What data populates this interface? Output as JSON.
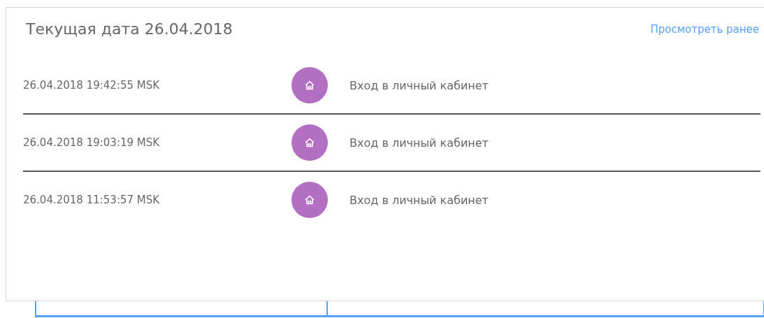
{
  "header": {
    "title": "Текущая дата 26.04.2018",
    "link": "Просмотреть ранее"
  },
  "events": [
    {
      "time": "26.04.2018 19:42:55 MSK",
      "kind": "login",
      "label": "Вход в личный кабинет"
    },
    {
      "time": "26.04.2018 19:03:19 MSK",
      "kind": "login",
      "label": "Вход в личный кабинет"
    },
    {
      "time": "26.04.2018 11:53:57 MSK",
      "kind": "login",
      "label": "Вход в личный кабинет"
    }
  ]
}
